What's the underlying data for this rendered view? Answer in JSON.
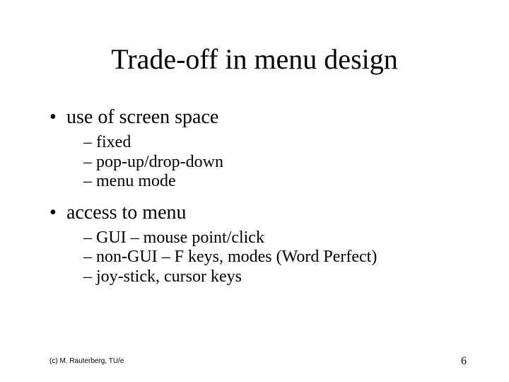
{
  "title": "Trade-off in menu design",
  "sections": [
    {
      "label": "use of screen space",
      "items": [
        "fixed",
        "pop-up/drop-down",
        "menu mode"
      ]
    },
    {
      "label": "access to menu",
      "items": [
        "GUI – mouse point/click",
        "non-GUI – F keys, modes (Word Perfect)",
        "joy-stick, cursor keys"
      ]
    }
  ],
  "footer_left": "(c) M. Rauterberg, TU/e",
  "footer_right": "6"
}
